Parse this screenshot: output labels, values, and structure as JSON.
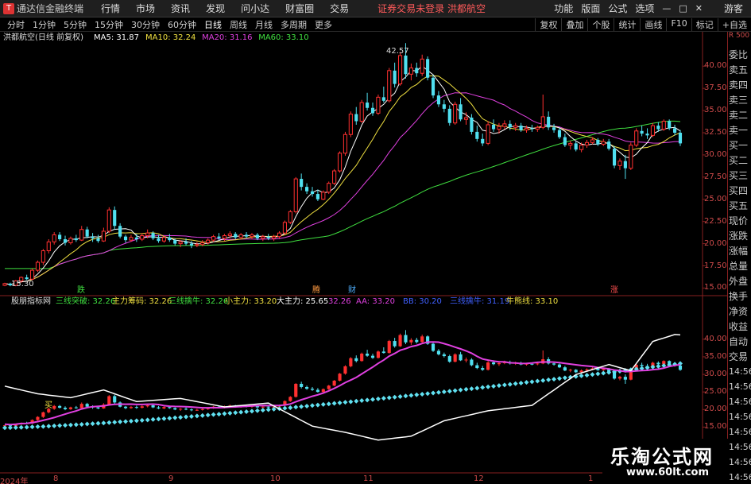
{
  "titlebar": {
    "app_name": "通达信金融终端",
    "menu": [
      "行情",
      "市场",
      "资讯",
      "发现",
      "问小达",
      "财富圈",
      "交易"
    ],
    "promo": "证券交易未登录  洪都航空",
    "right_menu": [
      "功能",
      "版面",
      "公式",
      "选项"
    ],
    "guest": "游客"
  },
  "toolbar": {
    "periods": [
      "分时",
      "1分钟",
      "5分钟",
      "15分钟",
      "30分钟",
      "60分钟",
      "日线",
      "周线",
      "月线",
      "多周期",
      "更多"
    ],
    "active_period": "日线",
    "right_items": [
      "复权",
      "叠加",
      "个股",
      "统计",
      "画线",
      "F10",
      "标记",
      "+自选"
    ]
  },
  "main_legend": {
    "stock": "洪都航空(日线 前复权)",
    "items": [
      {
        "label": "MA5: 31.87",
        "color": "#ffffff"
      },
      {
        "label": "MA10: 32.24",
        "color": "#f0e040"
      },
      {
        "label": "MA20: 31.16",
        "color": "#e040e0"
      },
      {
        "label": "MA60: 33.10",
        "color": "#40e040"
      }
    ]
  },
  "indicator_legend": {
    "name": "股朋指标网",
    "items": [
      {
        "label": "三线突破: 32.26",
        "color": "#40e040"
      },
      {
        "label": "主力筹码: 32.26",
        "color": "#f0e040"
      },
      {
        "label": "三线擒牛: 32.26",
        "color": "#40e040"
      },
      {
        "label": "小主力: 33.20",
        "color": "#f0e040"
      },
      {
        "label": "大主力: 25.65",
        "color": "#ffffff"
      },
      {
        "label": "32.26",
        "color": "#e040e0"
      },
      {
        "label": "AA: 33.20",
        "color": "#e040e0"
      },
      {
        "label": "BB: 30.20",
        "color": "#4060ff"
      },
      {
        "label": "三线擒牛: 31.19",
        "color": "#4060ff"
      },
      {
        "label": "牛熊线: 33.10",
        "color": "#f0e040"
      }
    ]
  },
  "main_y_ticks": [
    "40.00",
    "37.50",
    "35.00",
    "32.50",
    "30.00",
    "27.50",
    "25.00",
    "22.50",
    "20.00",
    "17.50",
    "15.00"
  ],
  "ind_y_ticks": [
    "40.00",
    "35.00",
    "30.00",
    "25.00",
    "20.00",
    "15.00"
  ],
  "x_labels": [
    "2024年",
    "8",
    "9",
    "10",
    "11",
    "12",
    "1"
  ],
  "annotations": {
    "high": "42.57",
    "low": "15.30",
    "buy": "买",
    "markers": [
      "跌",
      "腾",
      "财",
      "涨"
    ]
  },
  "sidebar": {
    "top": "R 500",
    "items": [
      "委比",
      "卖五",
      "卖四",
      "卖三",
      "卖二",
      "卖一",
      "买一",
      "买二",
      "买三",
      "买四",
      "买五",
      "现价",
      "涨跌",
      "涨幅",
      "总量",
      "外盘",
      "换手",
      "净资",
      "收益",
      "自动",
      "交易",
      "14:56",
      "14:56",
      "14:56",
      "14:56",
      "14:56",
      "14:56",
      "14:56",
      "14:56"
    ]
  },
  "watermark": {
    "title": "乐淘公式网",
    "url": "www.60lt.com"
  },
  "chart_data": {
    "type": "candlestick",
    "title": "洪都航空(日线 前复权)",
    "main_ylim": [
      14.5,
      42.8
    ],
    "ind_ylim": [
      13.5,
      42
    ],
    "candles": [
      [
        15.3,
        15.6,
        15.2,
        15.5
      ],
      [
        15.5,
        15.6,
        15.2,
        15.3
      ],
      [
        15.3,
        15.9,
        15.2,
        15.8
      ],
      [
        15.8,
        16.3,
        15.6,
        16.2
      ],
      [
        16.2,
        16.5,
        15.9,
        16.0
      ],
      [
        16.0,
        17.2,
        15.9,
        17.0
      ],
      [
        17.0,
        18.1,
        16.8,
        17.9
      ],
      [
        17.9,
        19.4,
        17.6,
        19.2
      ],
      [
        19.2,
        20.5,
        18.9,
        20.2
      ],
      [
        20.2,
        21.3,
        19.9,
        21.0
      ],
      [
        21.0,
        21.3,
        20.3,
        20.5
      ],
      [
        20.5,
        20.9,
        19.8,
        20.1
      ],
      [
        20.1,
        20.8,
        19.9,
        20.6
      ],
      [
        20.6,
        21.0,
        20.2,
        20.4
      ],
      [
        20.4,
        22.0,
        20.3,
        21.6
      ],
      [
        21.6,
        21.9,
        20.6,
        20.8
      ],
      [
        20.8,
        21.2,
        20.2,
        20.6
      ],
      [
        20.6,
        21.0,
        20.1,
        20.3
      ],
      [
        20.3,
        21.8,
        20.2,
        21.4
      ],
      [
        21.4,
        24.1,
        21.2,
        23.8
      ],
      [
        23.8,
        24.2,
        21.6,
        22.0
      ],
      [
        22.0,
        22.3,
        20.6,
        20.8
      ],
      [
        20.8,
        21.0,
        20.1,
        20.4
      ],
      [
        20.4,
        21.0,
        20.2,
        20.7
      ],
      [
        20.7,
        21.1,
        20.2,
        20.5
      ],
      [
        20.5,
        21.2,
        20.3,
        20.9
      ],
      [
        20.9,
        21.6,
        20.6,
        21.2
      ],
      [
        21.2,
        21.4,
        20.4,
        20.6
      ],
      [
        20.6,
        21.0,
        20.1,
        20.3
      ],
      [
        20.3,
        20.9,
        20.1,
        20.7
      ],
      [
        20.7,
        21.1,
        20.2,
        20.4
      ],
      [
        20.4,
        20.6,
        19.8,
        20.0
      ],
      [
        20.0,
        20.4,
        19.6,
        20.2
      ],
      [
        20.2,
        20.6,
        19.8,
        20.0
      ],
      [
        20.0,
        20.3,
        19.5,
        19.8
      ],
      [
        19.8,
        20.2,
        19.6,
        19.9
      ],
      [
        19.9,
        20.4,
        19.7,
        20.1
      ],
      [
        20.1,
        20.6,
        19.9,
        20.4
      ],
      [
        20.4,
        21.0,
        20.2,
        20.8
      ],
      [
        20.8,
        21.2,
        20.4,
        20.6
      ],
      [
        20.6,
        21.1,
        20.3,
        20.9
      ],
      [
        20.9,
        21.4,
        20.6,
        21.1
      ],
      [
        21.1,
        21.3,
        20.5,
        20.7
      ],
      [
        20.7,
        21.2,
        20.5,
        21.0
      ],
      [
        21.0,
        21.3,
        20.6,
        20.8
      ],
      [
        20.8,
        21.2,
        20.5,
        21.0
      ],
      [
        21.0,
        21.2,
        20.4,
        20.6
      ],
      [
        20.6,
        21.0,
        20.3,
        20.8
      ],
      [
        20.8,
        21.1,
        20.4,
        20.6
      ],
      [
        20.6,
        21.0,
        20.3,
        20.8
      ],
      [
        20.8,
        21.4,
        20.6,
        21.2
      ],
      [
        21.2,
        22.6,
        21.0,
        22.4
      ],
      [
        22.4,
        23.8,
        22.2,
        23.6
      ],
      [
        23.6,
        27.5,
        23.4,
        27.3
      ],
      [
        27.3,
        27.9,
        26.0,
        26.4
      ],
      [
        26.4,
        26.8,
        25.6,
        25.9
      ],
      [
        25.9,
        26.4,
        25.3,
        25.6
      ],
      [
        25.6,
        26.1,
        24.8,
        25.0
      ],
      [
        25.0,
        26.0,
        24.9,
        25.8
      ],
      [
        25.8,
        27.0,
        25.6,
        26.8
      ],
      [
        26.8,
        28.4,
        26.6,
        28.2
      ],
      [
        28.2,
        30.4,
        28.0,
        30.2
      ],
      [
        30.2,
        32.6,
        29.9,
        32.3
      ],
      [
        32.3,
        34.9,
        32.0,
        34.6
      ],
      [
        34.6,
        35.4,
        33.4,
        33.8
      ],
      [
        33.8,
        36.2,
        33.6,
        35.9
      ],
      [
        35.9,
        37.0,
        35.0,
        35.3
      ],
      [
        35.3,
        35.9,
        34.4,
        34.7
      ],
      [
        34.7,
        36.8,
        34.5,
        36.5
      ],
      [
        36.5,
        37.7,
        35.9,
        36.1
      ],
      [
        36.1,
        39.8,
        35.9,
        39.5
      ],
      [
        39.5,
        40.4,
        37.6,
        38.0
      ],
      [
        38.0,
        41.6,
        37.8,
        41.2
      ],
      [
        41.2,
        42.6,
        38.6,
        39.1
      ],
      [
        39.1,
        40.3,
        38.4,
        39.8
      ],
      [
        39.8,
        40.4,
        38.8,
        39.2
      ],
      [
        39.2,
        41.3,
        38.9,
        40.8
      ],
      [
        40.8,
        41.1,
        38.4,
        38.7
      ],
      [
        38.7,
        39.0,
        36.4,
        36.7
      ],
      [
        36.7,
        37.2,
        35.4,
        35.7
      ],
      [
        35.7,
        36.2,
        34.8,
        35.2
      ],
      [
        35.2,
        35.6,
        33.3,
        33.6
      ],
      [
        33.6,
        36.0,
        33.4,
        35.7
      ],
      [
        35.7,
        36.4,
        33.8,
        34.0
      ],
      [
        34.0,
        34.8,
        33.4,
        34.2
      ],
      [
        34.2,
        34.6,
        32.3,
        32.6
      ],
      [
        32.6,
        33.3,
        31.5,
        31.8
      ],
      [
        31.8,
        32.4,
        31.0,
        31.3
      ],
      [
        31.3,
        33.8,
        31.1,
        33.4
      ],
      [
        33.4,
        34.0,
        32.6,
        32.9
      ],
      [
        32.9,
        33.6,
        32.4,
        33.2
      ],
      [
        33.2,
        33.9,
        32.9,
        33.5
      ],
      [
        33.5,
        33.9,
        32.8,
        33.1
      ],
      [
        33.1,
        33.6,
        32.7,
        33.3
      ],
      [
        33.3,
        33.6,
        32.6,
        32.8
      ],
      [
        32.8,
        33.3,
        32.5,
        33.0
      ],
      [
        33.0,
        33.4,
        32.6,
        32.9
      ],
      [
        32.9,
        33.3,
        32.6,
        33.1
      ],
      [
        33.1,
        36.8,
        32.9,
        34.3
      ],
      [
        34.3,
        34.9,
        32.8,
        33.1
      ],
      [
        33.1,
        33.5,
        32.5,
        32.8
      ],
      [
        32.8,
        33.1,
        31.8,
        32.0
      ],
      [
        32.0,
        32.4,
        30.9,
        31.1
      ],
      [
        31.1,
        31.6,
        30.6,
        31.3
      ],
      [
        31.3,
        31.5,
        30.4,
        30.6
      ],
      [
        30.6,
        31.4,
        30.3,
        31.1
      ],
      [
        31.1,
        31.7,
        30.8,
        31.4
      ],
      [
        31.4,
        32.0,
        31.2,
        31.7
      ],
      [
        31.7,
        31.9,
        31.0,
        31.2
      ],
      [
        31.2,
        31.8,
        31.0,
        31.5
      ],
      [
        31.5,
        31.8,
        30.5,
        30.7
      ],
      [
        30.7,
        31.0,
        28.5,
        28.8
      ],
      [
        28.8,
        29.6,
        28.3,
        29.3
      ],
      [
        29.3,
        30.0,
        27.3,
        28.5
      ],
      [
        28.5,
        31.4,
        28.3,
        31.1
      ],
      [
        31.1,
        33.0,
        30.9,
        32.7
      ],
      [
        32.7,
        33.3,
        32.1,
        32.4
      ],
      [
        32.4,
        33.0,
        31.8,
        32.2
      ],
      [
        32.2,
        33.6,
        32.0,
        33.3
      ],
      [
        33.3,
        33.7,
        32.6,
        32.9
      ],
      [
        32.9,
        34.0,
        32.7,
        33.8
      ],
      [
        33.8,
        34.0,
        32.8,
        33.0
      ],
      [
        33.0,
        33.4,
        32.2,
        32.5
      ],
      [
        32.5,
        32.8,
        31.0,
        31.3
      ]
    ],
    "series": [
      {
        "name": "MA5",
        "value": 31.87,
        "color": "#ffffff"
      },
      {
        "name": "MA10",
        "value": 32.24,
        "color": "#f0e040"
      },
      {
        "name": "MA20",
        "value": 31.16,
        "color": "#e040e0"
      },
      {
        "name": "MA60",
        "value": 33.1,
        "color": "#40e040"
      }
    ],
    "x_tick_labels": [
      "2024年",
      "8",
      "9",
      "10",
      "11",
      "12",
      "1"
    ]
  }
}
